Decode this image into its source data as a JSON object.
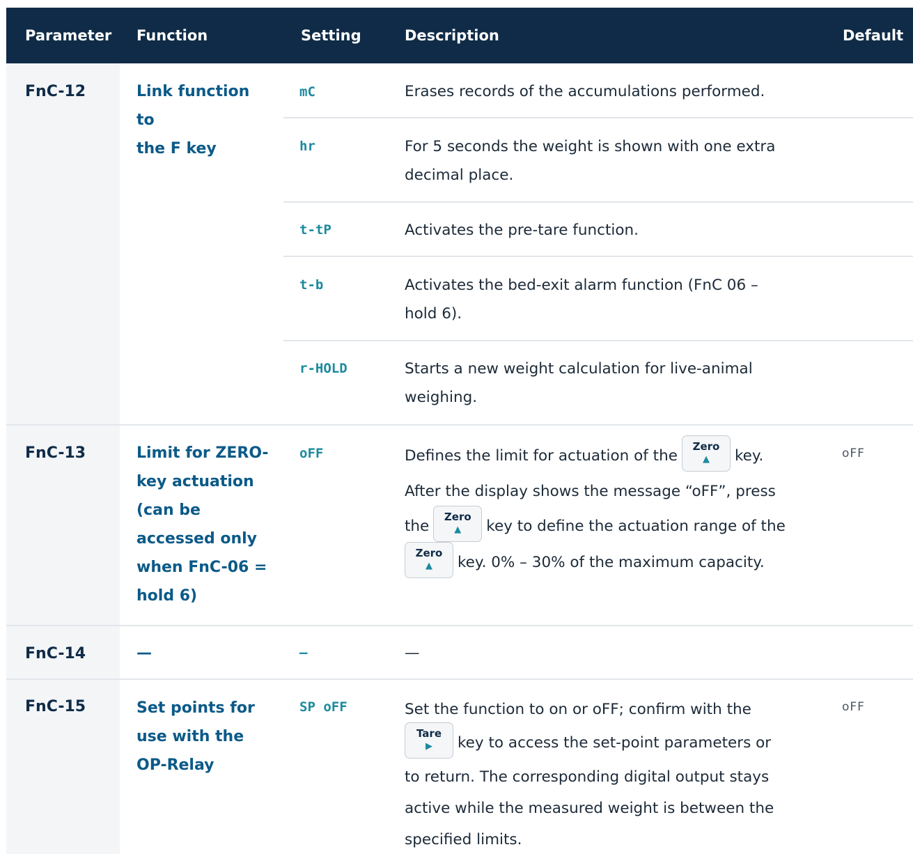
{
  "headers": {
    "parameter": "Parameter",
    "function": "Function",
    "setting": "Setting",
    "description": "Description",
    "default": "Default"
  },
  "rows": [
    {
      "param": "FnC-12",
      "function_lines": [
        "Link function to",
        "the F key"
      ],
      "default": "",
      "settings": [
        {
          "code": "mC",
          "desc": [
            "Erases records of the accumulations performed."
          ]
        },
        {
          "code": "hr",
          "desc": [
            "For 5 seconds the weight is shown with one extra",
            "decimal place."
          ]
        },
        {
          "code": "t-tP",
          "desc": [
            "Activates the pre-tare function."
          ]
        },
        {
          "code": "t-b",
          "desc": [
            "Activates the bed-exit alarm function (FnC 06 –",
            "hold 6)."
          ]
        },
        {
          "code": "r-HOLD",
          "desc": [
            "Starts a new weight calculation for live-animal",
            "weighing."
          ]
        }
      ]
    },
    {
      "param": "FnC-13",
      "function_lines": [
        "Limit for ZERO-",
        "key actuation",
        "(can be",
        "accessed only",
        "when FnC-06 =",
        "hold 6)"
      ],
      "setting": "oFF",
      "default": "oFF",
      "desc": {
        "l1_a": "Defines the limit for actuation of the",
        "l1_b": "key.",
        "l2": "After the display shows the message “oFF”, press",
        "l3_a": "the",
        "l3_b": "key to define the actuation range of the",
        "l4_b": "key. 0% – 30% of the maximum capacity."
      }
    },
    {
      "param": "FnC-14",
      "function": "—",
      "setting": "–",
      "desc": "—",
      "default": ""
    },
    {
      "param": "FnC-15",
      "function_lines": [
        "Set points for",
        "use with the",
        "OP-Relay"
      ],
      "setting": "SP oFF",
      "default": "oFF",
      "desc": {
        "l1": "Set the function to on or oFF; confirm with the",
        "l2_b": "key to access the set-point parameters or",
        "l3": "to return. The corresponding digital output stays",
        "l4": "active while the measured weight is between the",
        "l5": "specified limits."
      }
    }
  ],
  "keys": {
    "zero_label": "Zero",
    "zero_glyph": "▲",
    "tare_label": "Tare",
    "tare_glyph": "▶"
  },
  "colors": {
    "header_bg": "#0f2b47",
    "function_text": "#0b5a88",
    "setting_text": "#1b8a9e",
    "row_bg": "#f3f5f7"
  }
}
